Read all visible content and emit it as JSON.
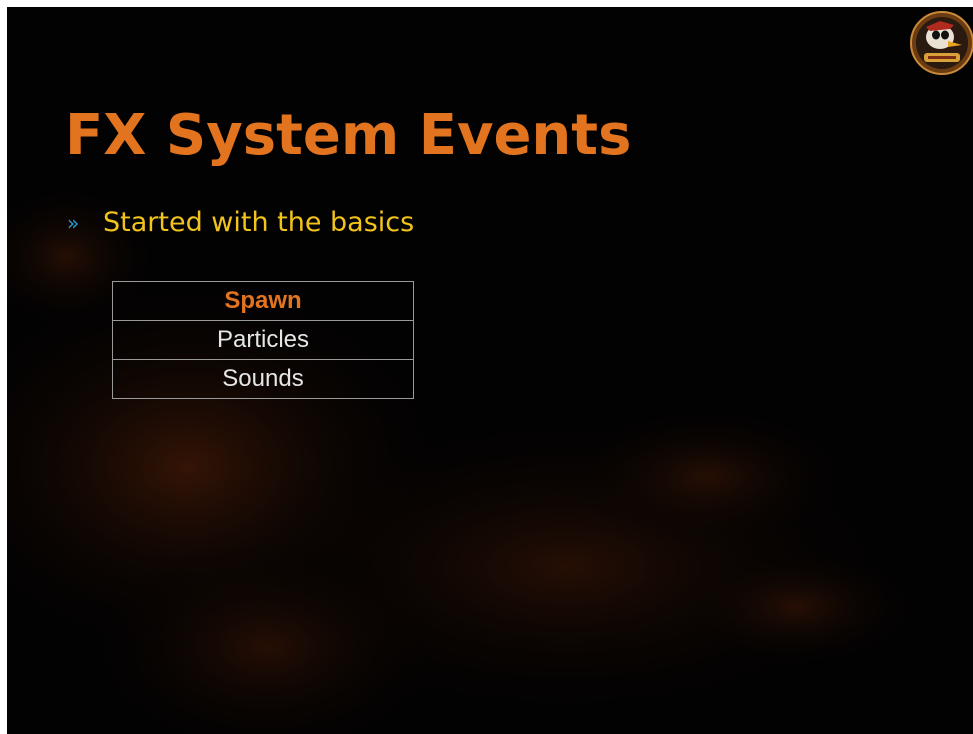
{
  "slide": {
    "title": "FX System Events",
    "bullets": [
      {
        "marker": "»",
        "text": "Started with the basics"
      }
    ],
    "event_table": {
      "rows": [
        {
          "label": "Spawn",
          "highlight": true
        },
        {
          "label": "Particles",
          "highlight": false
        },
        {
          "label": "Sounds",
          "highlight": false
        }
      ]
    },
    "logo": {
      "icon": "game-logo-mascot-badge"
    }
  },
  "colors": {
    "background": "#030202",
    "title": "#e3741f",
    "bullet_marker": "#2a9fd6",
    "bullet_text": "#f2c21d",
    "highlight": "#e3741f",
    "table_text": "#e6e6e6",
    "table_border": "#9a9a9a"
  }
}
